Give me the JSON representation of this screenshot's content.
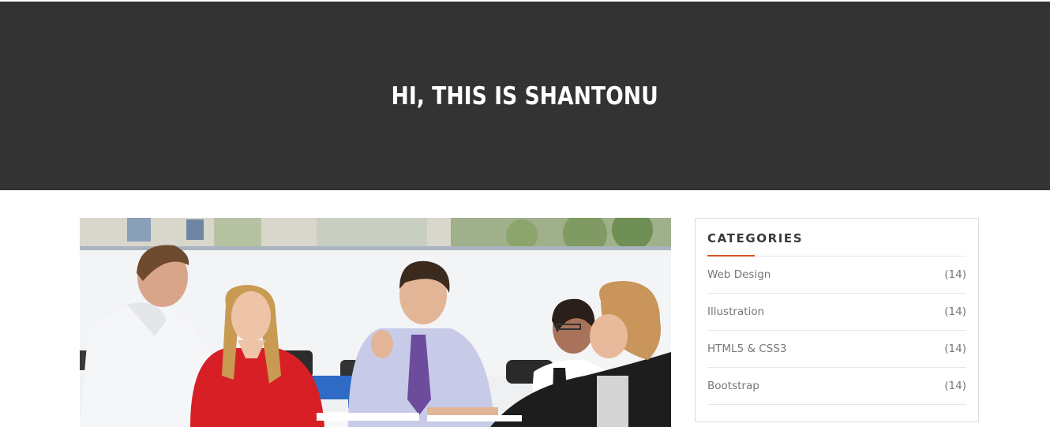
{
  "hero": {
    "title": "HI, THIS IS SHANTONU",
    "background_color": "#333333"
  },
  "post": {
    "image_description": "photo-meeting-team-at-table"
  },
  "sidebar": {
    "categories_widget": {
      "title": "CATEGORIES",
      "accent_color": "#d9541e",
      "items": [
        {
          "label": "Web Design",
          "count": "(14)"
        },
        {
          "label": "Illustration",
          "count": "(14)"
        },
        {
          "label": "HTML5 & CSS3",
          "count": "(14)"
        },
        {
          "label": "Bootstrap",
          "count": "(14)"
        }
      ]
    }
  }
}
